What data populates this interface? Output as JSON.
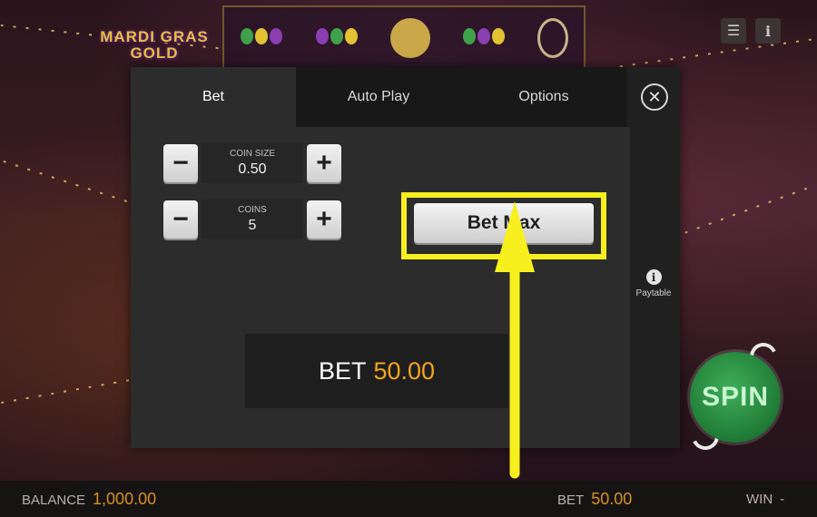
{
  "scene": {
    "logo_line1": "MARDI GRAS",
    "logo_line2": "GOLD",
    "menu_icon": "menu-icon",
    "info_icon": "info-icon"
  },
  "modal": {
    "tabs": [
      {
        "label": "Bet",
        "active": true
      },
      {
        "label": "Auto Play",
        "active": false
      },
      {
        "label": "Options",
        "active": false
      }
    ],
    "close_icon": "close-icon",
    "coin_size": {
      "label": "COIN SIZE",
      "value": "0.50"
    },
    "coins": {
      "label": "COINS",
      "value": "5"
    },
    "minus_glyph": "−",
    "plus_glyph": "+",
    "bet_max_label": "Bet Max",
    "bet": {
      "label": "BET",
      "value": "50.00"
    },
    "paytable_label": "Paytable"
  },
  "spin": {
    "label": "SPIN"
  },
  "bottombar": {
    "balance_label": "BALANCE",
    "balance_value": "1,000.00",
    "bet_label": "BET",
    "bet_value": "50.00",
    "win_label": "WIN",
    "win_value": "-"
  },
  "colors": {
    "highlight": "#f7f01e",
    "bet_value": "#f3a51a",
    "spin_green": "#1f7a35",
    "modal_bg": "#2c2c2c"
  }
}
